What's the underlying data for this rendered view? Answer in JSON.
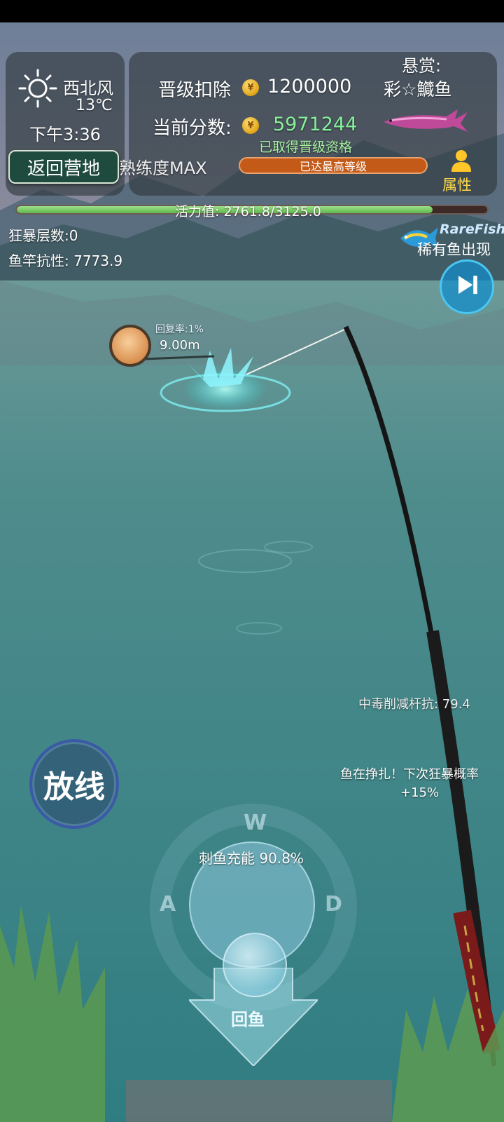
{
  "weather": {
    "wind": "西北风",
    "temperature": "13℃",
    "time": "下午3:36",
    "icon": "sun-icon"
  },
  "nav": {
    "back_label": "返回营地"
  },
  "upgrade": {
    "deduct_label": "晋级扣除",
    "deduct_value": "1200000",
    "score_label": "当前分数:",
    "score_value": "5971244",
    "qualified_text": "已取得晋级资格",
    "proficiency": "熟练度MAX",
    "level_text": "已达最高等级",
    "coin_glyph": "¥"
  },
  "bounty": {
    "label": "悬赏:",
    "fish_name": "彩☆鱵鱼"
  },
  "attributes": {
    "label": "属性"
  },
  "stamina": {
    "text": "活力值: 2761.8/3125.0",
    "current": 2761.8,
    "max": 3125.0
  },
  "stats": {
    "rage": "狂暴层数:0",
    "rod_resistance": "鱼竿抗性: 7773.9"
  },
  "rare": {
    "en": "RareFish",
    "cn": "稀有鱼出现"
  },
  "float": {
    "recover_rate": "回复率:1%",
    "distance": "9.00m"
  },
  "notes": {
    "poison": "中毒削减杆抗: 79.4",
    "struggle": "鱼在挣扎！下次狂暴概率",
    "struggle_pct": "+15%"
  },
  "controls": {
    "release_label": "放线",
    "key_w": "W",
    "key_a": "A",
    "key_d": "D",
    "charge_text": "刺鱼充能 90.8%",
    "reel_label": "回鱼"
  }
}
